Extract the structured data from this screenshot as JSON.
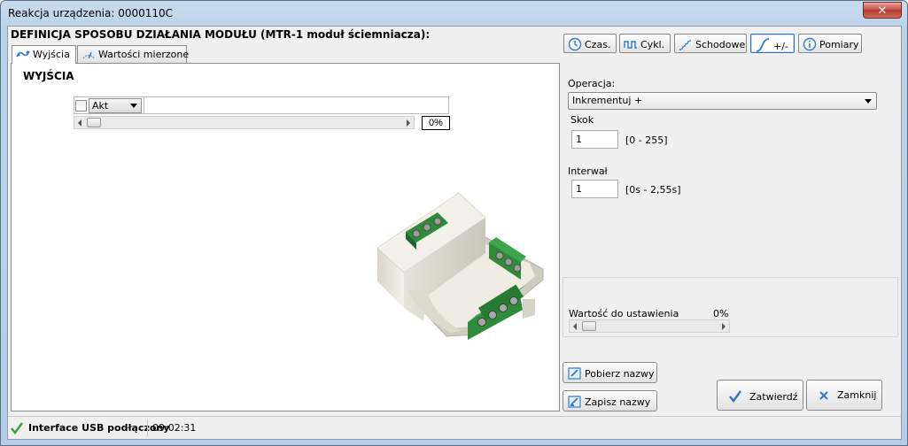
{
  "window": {
    "title": "Reakcja urządzenia: 0000110C",
    "close_label": "✕"
  },
  "heading": "DEFINICJA SPOSOBU DZIAŁANIA MODUŁU (MTR-1 moduł ściemniacza):",
  "tabs": [
    {
      "label": "Wyjścia",
      "active": true,
      "icon": "outputs-icon"
    },
    {
      "label": "Wartości mierzone",
      "active": false,
      "icon": "gauge-icon"
    }
  ],
  "outputs": {
    "title": "WYJŚCIA",
    "checked": false,
    "mode_value": "Akt",
    "name_value": "",
    "slider_percent": 0,
    "percent_label": "0%"
  },
  "toolbar": [
    {
      "label": "Czas.",
      "icon": "clock-icon",
      "active": false
    },
    {
      "label": "Cykl.",
      "icon": "pulse-wave-icon",
      "active": false
    },
    {
      "label": "Schodowe",
      "icon": "stairs-icon",
      "active": false
    },
    {
      "label": "+/-",
      "icon": "ramp-curve-icon",
      "active": true
    },
    {
      "label": "Pomiary",
      "icon": "info-icon",
      "active": false
    }
  ],
  "settings": {
    "operation_label": "Operacja:",
    "operation_value": "Inkrementuj +",
    "step_label": "Skok",
    "step_value": "1",
    "step_range": "[0 - 255]",
    "interval_label": "Interwał",
    "interval_value": "1",
    "interval_range": "[0s - 2,55s]",
    "target_label": "Wartość do ustawienia",
    "target_percent_label": "0%",
    "target_percent": 0
  },
  "buttons": {
    "fetch_names": "Pobierz nazwy",
    "save_names": "Zapisz nazwy",
    "confirm": "Zatwierdź",
    "close": "Zamknij"
  },
  "status": {
    "connection": "Interface USB podłączony",
    "time": "09:02:31"
  },
  "colors": {
    "accent": "#2e6db0",
    "confirm_check": "#2a78c8",
    "terminal_green": "#2e8b3a",
    "device_body": "#eeece2"
  }
}
